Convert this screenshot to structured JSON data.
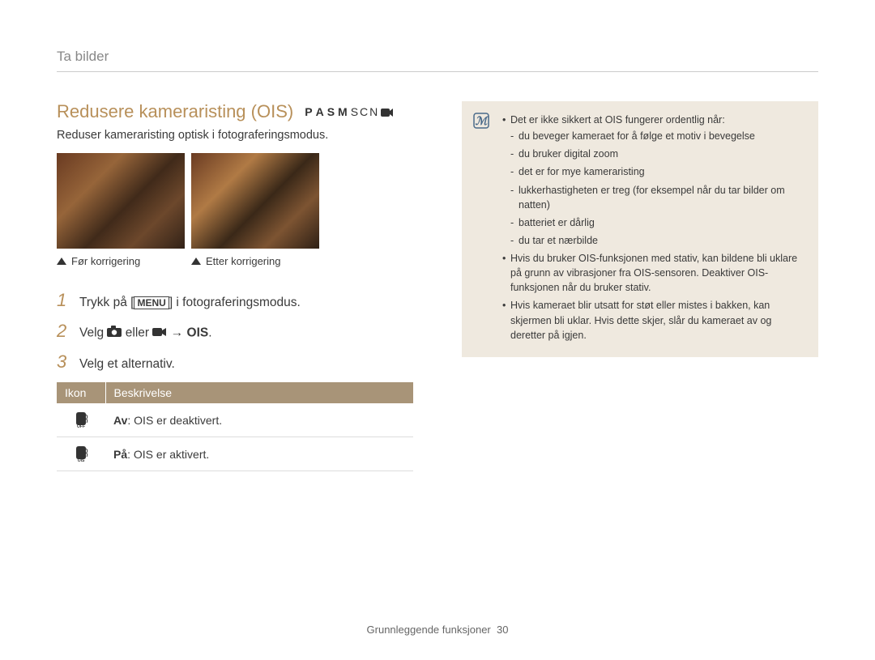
{
  "breadcrumb": "Ta bilder",
  "title": "Redusere kameraristing (OIS)",
  "modes": {
    "p": "P",
    "a": "A",
    "s": "S",
    "m": "M",
    "scn": "SCN"
  },
  "subtitle": "Reduser kameraristing optisk i fotograferingsmodus.",
  "captions": {
    "before": "Før korrigering",
    "after": "Etter korrigering"
  },
  "steps": {
    "s1": {
      "num": "1",
      "pre": "Trykk på [",
      "menu": "MENU",
      "post": "] i fotograferingsmodus."
    },
    "s2": {
      "num": "2",
      "pre": "Velg ",
      "mid": " eller ",
      "arrow": " → ",
      "ois": "OIS",
      "end": "."
    },
    "s3": {
      "num": "3",
      "text": "Velg et alternativ."
    }
  },
  "table": {
    "headers": {
      "icon": "Ikon",
      "desc": "Beskrivelse"
    },
    "rows": [
      {
        "label": "Av",
        "desc": ": OIS er deaktivert."
      },
      {
        "label": "På",
        "desc": ": OIS er aktivert."
      }
    ]
  },
  "notes": {
    "intro": "Det er ikke sikkert at OIS fungerer ordentlig når:",
    "subs": [
      "du beveger kameraet for å følge et motiv i bevegelse",
      "du bruker digital zoom",
      "det er for mye kameraristing",
      "lukkerhastigheten er treg (for eksempel når du tar bilder om natten)",
      "batteriet er dårlig",
      "du tar et nærbilde"
    ],
    "b2": "Hvis du bruker OIS-funksjonen med stativ, kan bildene bli uklare på grunn av vibrasjoner fra OIS-sensoren. Deaktiver OIS-funksjonen når du bruker stativ.",
    "b3": "Hvis kameraet blir utsatt for støt eller mistes i bakken, kan skjermen bli uklar. Hvis dette skjer, slår du kameraet av og deretter på igjen."
  },
  "footer": {
    "section": "Grunnleggende funksjoner",
    "page": "30"
  }
}
